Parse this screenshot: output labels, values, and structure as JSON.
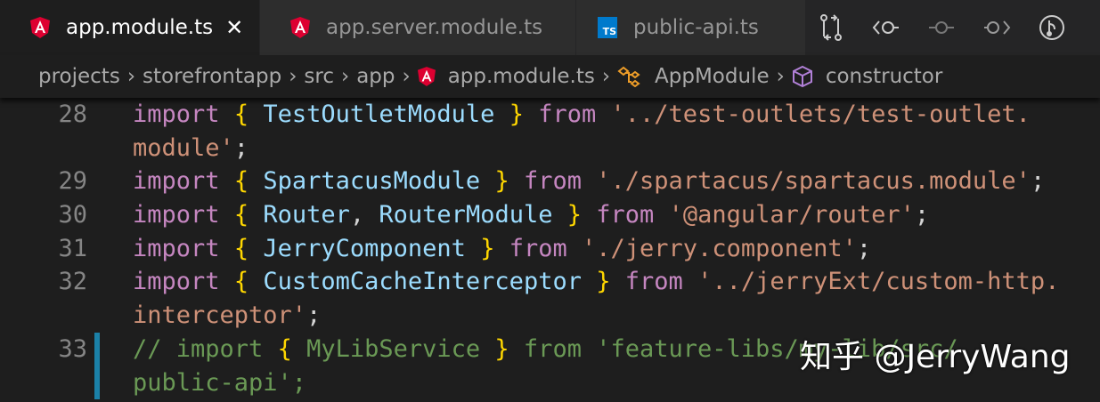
{
  "tabs": [
    {
      "label": "app.module.ts",
      "icon": "angular-icon",
      "active": true,
      "close": "✕"
    },
    {
      "label": "app.server.module.ts",
      "icon": "angular-icon",
      "active": false
    },
    {
      "label": "public-api.ts",
      "icon": "typescript-icon",
      "active": false,
      "icon_text": "TS"
    }
  ],
  "breadcrumbs": [
    "projects",
    "storefrontapp",
    "src",
    "app",
    "app.module.ts",
    "AppModule",
    "constructor"
  ],
  "lines": [
    {
      "num": "28",
      "rows": [
        [
          [
            "kw",
            "import"
          ],
          [
            "pl",
            " "
          ],
          [
            "br",
            "{"
          ],
          [
            "pl",
            " "
          ],
          [
            "id",
            "TestOutletModule"
          ],
          [
            "pl",
            " "
          ],
          [
            "br",
            "}"
          ],
          [
            "pl",
            " "
          ],
          [
            "kw",
            "from"
          ],
          [
            "pl",
            " "
          ],
          [
            "st",
            "'../test-outlets/test-outlet."
          ]
        ],
        [
          [
            "st",
            "module'"
          ],
          [
            "pl",
            ";"
          ]
        ]
      ]
    },
    {
      "num": "29",
      "rows": [
        [
          [
            "kw",
            "import"
          ],
          [
            "pl",
            " "
          ],
          [
            "br",
            "{"
          ],
          [
            "pl",
            " "
          ],
          [
            "id",
            "SpartacusModule"
          ],
          [
            "pl",
            " "
          ],
          [
            "br",
            "}"
          ],
          [
            "pl",
            " "
          ],
          [
            "kw",
            "from"
          ],
          [
            "pl",
            " "
          ],
          [
            "st",
            "'./spartacus/spartacus.module'"
          ],
          [
            "pl",
            ";"
          ]
        ]
      ]
    },
    {
      "num": "30",
      "rows": [
        [
          [
            "kw",
            "import"
          ],
          [
            "pl",
            " "
          ],
          [
            "br",
            "{"
          ],
          [
            "pl",
            " "
          ],
          [
            "id",
            "Router"
          ],
          [
            "pl",
            ", "
          ],
          [
            "id",
            "RouterModule"
          ],
          [
            "pl",
            " "
          ],
          [
            "br",
            "}"
          ],
          [
            "pl",
            " "
          ],
          [
            "kw",
            "from"
          ],
          [
            "pl",
            " "
          ],
          [
            "st",
            "'@angular/router'"
          ],
          [
            "pl",
            ";"
          ]
        ]
      ]
    },
    {
      "num": "31",
      "rows": [
        [
          [
            "kw",
            "import"
          ],
          [
            "pl",
            " "
          ],
          [
            "br",
            "{"
          ],
          [
            "pl",
            " "
          ],
          [
            "id",
            "JerryComponent"
          ],
          [
            "pl",
            " "
          ],
          [
            "br",
            "}"
          ],
          [
            "pl",
            " "
          ],
          [
            "kw",
            "from"
          ],
          [
            "pl",
            " "
          ],
          [
            "st",
            "'./jerry.component'"
          ],
          [
            "pl",
            ";"
          ]
        ]
      ]
    },
    {
      "num": "32",
      "rows": [
        [
          [
            "kw",
            "import"
          ],
          [
            "pl",
            " "
          ],
          [
            "br",
            "{"
          ],
          [
            "pl",
            " "
          ],
          [
            "id",
            "CustomCacheInterceptor"
          ],
          [
            "pl",
            " "
          ],
          [
            "br",
            "}"
          ],
          [
            "pl",
            " "
          ],
          [
            "kw",
            "from"
          ],
          [
            "pl",
            " "
          ],
          [
            "st",
            "'../jerryExt/custom-http."
          ]
        ],
        [
          [
            "st",
            "interceptor'"
          ],
          [
            "pl",
            ";"
          ]
        ]
      ]
    },
    {
      "num": "33",
      "modified": true,
      "rows": [
        [
          [
            "cm",
            "// import "
          ],
          [
            "br",
            "{"
          ],
          [
            "cm",
            " MyLibService "
          ],
          [
            "br",
            "}"
          ],
          [
            "cm",
            " from 'feature-libs/my-lib/src/"
          ]
        ],
        [
          [
            "cm",
            "public-api';"
          ]
        ]
      ]
    }
  ],
  "watermark": "知乎 @JerryWang",
  "colors": {
    "accent": "#1b81a8",
    "angular": "#dd0031",
    "ts": "#007acc"
  }
}
